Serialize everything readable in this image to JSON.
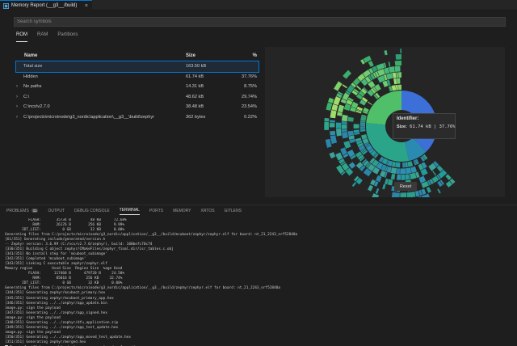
{
  "tab": {
    "title": "Memory Report (__g3__/build)",
    "close": "×",
    "icon": "memory-report-icon"
  },
  "search": {
    "placeholder": "Search symbols",
    "value": ""
  },
  "subtabs": [
    "ROM",
    "RAM",
    "Partitions"
  ],
  "table": {
    "headers": {
      "name": "Name",
      "size": "Size",
      "pct": "%"
    },
    "rows": [
      {
        "name": "Total size",
        "size": "163.50 kB",
        "pct": "",
        "expand": false,
        "selected": true
      },
      {
        "name": "Hidden",
        "size": "61.74 kB",
        "pct": "37.76%",
        "expand": false
      },
      {
        "name": "No paths",
        "size": "14.31 kB",
        "pct": "8.75%",
        "expand": true
      },
      {
        "name": "C:\\",
        "size": "48.62 kB",
        "pct": "29.74%",
        "expand": true
      },
      {
        "name": "C:\\ncs\\v2.7.0",
        "size": "38.48 kB",
        "pct": "23.54%",
        "expand": true
      },
      {
        "name": "C:\\projects\\microinode\\g3_nordic\\application\\__g3__\\build\\zephyr",
        "size": "362 bytes",
        "pct": "0.22%",
        "expand": true
      }
    ]
  },
  "tooltip": {
    "title": "Identifier:",
    "label": "Size:",
    "value": "61.74 kB | 37.76%"
  },
  "reset_label": "Reset",
  "colors": {
    "accent": "#0078d4",
    "sunburst_blue": "#3d6fd9",
    "sunburst_teal": "#2a9d8f",
    "sunburst_green": "#5cc95c"
  },
  "panel_tabs": [
    {
      "label": "PROBLEMS",
      "badge": "11"
    },
    {
      "label": "OUTPUT"
    },
    {
      "label": "DEBUG CONSOLE"
    },
    {
      "label": "TERMINAL",
      "active": true
    },
    {
      "label": "PORTS"
    },
    {
      "label": "MEMORY"
    },
    {
      "label": "XRTOS"
    },
    {
      "label": "GITLENS"
    }
  ],
  "terminal_lines": [
    "           FLASH:       35734 B         48 KB      72.68%",
    "             RAM:       26176 B        256 KB      9.99%",
    "        IDT_LIST:          0 GB         32 KB      0.00%",
    "Generating files from C:/projects/microinode/g3_nordic/application/__g3__/build/mcuboot/zephyr/zephyr.elf for board: nt_21_2243_nrf52840a",
    "[61/351] Generating include/generated/version.h",
    "-- Zephyr version: 3.6.99 (C:/ncs/v2.7.0/zephyr), build: 100befc70c74",
    "[330/351] Building C object zephyr/CMakeFiles/zephyr_final.dir/isr_tables.c.obj",
    "[341/351] No install step for 'mcuboot_subimage'",
    "[342/351] Completed 'mcuboot_subimage'",
    "[343/351] Linking C executable zephyr/zephyr.elf",
    "Memory region         Used Size  Region Size  %age Used",
    "           FLASH:      117460 B      479720 B     24.50%",
    "             RAM:       85016 B       256 KB     32.74%",
    "        IDT_LIST:          0 GB        32 KB      0.00%",
    "Generating files from C:/projects/microinode/g3_nordic/application/__g3__/build/zephyr/zephyr.elf for board: nt_21_2243_nrf52840a",
    "[344/351] Generating zephyr/mcuboot_primary.hex",
    "[345/351] Generating zephyr/mcuboot_primary_app.hex",
    "[346/351] Generating ../../zephyr/app_update.bin",
    "image.py: sign the payload",
    "[347/351] Generating ../../zephyr/app_signed.hex",
    "image.py: sign the payload",
    "[348/351] Generating ../../zephyr/dfu_application.zip",
    "[349/351] Generating ../../zephyr/app_test_update.hex",
    "image.py: sign the payload",
    "[350/351] Generating ../../zephyr/app_moved_test_update.hex",
    "[351/351] Generating zephyr/merged.hex",
    "Terminal will be reused by tasks, press any key to close it."
  ]
}
